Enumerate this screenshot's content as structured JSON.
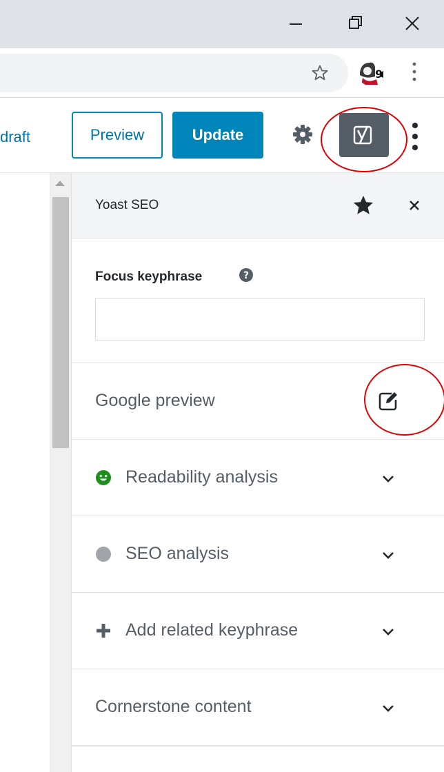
{
  "window": {
    "controls": [
      "minimize-icon",
      "restore-icon",
      "close-icon"
    ]
  },
  "toolbar": {
    "bookmark_icon": "star-outline-icon",
    "profile_icon": "avatar",
    "menu_icon": "kebab-icon"
  },
  "editor": {
    "save_draft_label": "draft",
    "preview_label": "Preview",
    "update_label": "Update",
    "settings_icon": "gear-icon",
    "yoast_icon": "yoast-logo-icon",
    "more_icon": "kebab-icon"
  },
  "sidebar": {
    "title": "Yoast SEO",
    "focus_keyphrase": {
      "label": "Focus keyphrase",
      "value": ""
    },
    "rows": [
      {
        "label": "Google preview",
        "icon": "edit-icon"
      },
      {
        "label": "Readability analysis",
        "icon": "smiley-icon",
        "status_color": "#1e8e1e"
      },
      {
        "label": "SEO analysis",
        "icon": "gray-dot-icon",
        "status_color": "#a0a5aa"
      },
      {
        "label": "Add related keyphrase",
        "icon": "plus-icon"
      },
      {
        "label": "Cornerstone content"
      }
    ]
  },
  "colors": {
    "accent": "#0085ba",
    "link": "#0073aa",
    "annotation": "#e00000"
  }
}
